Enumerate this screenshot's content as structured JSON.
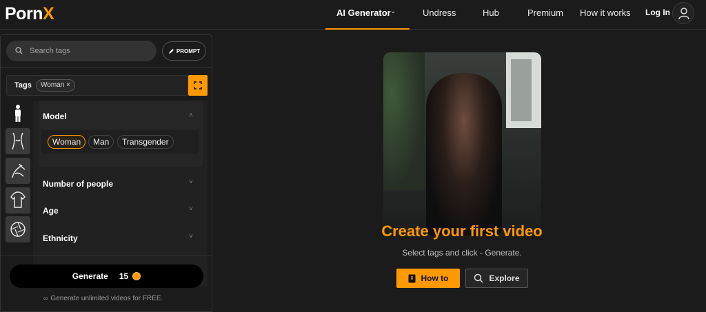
{
  "brand": {
    "logo_main": "Porn",
    "logo_accent": "X",
    "accent_color": "#ff9900"
  },
  "nav": {
    "active_label": "AI Generator",
    "items": [
      "Undress",
      "Hub",
      "Premium",
      "How it works"
    ],
    "login": "Log In"
  },
  "panel": {
    "search_placeholder": "Search tags",
    "prompt_label": "PROMPT",
    "tags_label": "Tags",
    "selected_tag": "Woman ×",
    "sections": {
      "model": {
        "title": "Model",
        "options": [
          "Woman",
          "Man",
          "Transgender"
        ],
        "selected": "Woman"
      },
      "number_of_people": {
        "title": "Number of people"
      },
      "age": {
        "title": "Age"
      },
      "ethnicity": {
        "title": "Ethnicity"
      }
    },
    "side_icons": [
      "person-icon",
      "body-icon",
      "pose-icon",
      "clothing-icon",
      "camera-lens-icon"
    ],
    "generate_label": "Generate",
    "generate_cost": "15",
    "free_note": "Generate unlimited videos for FREE."
  },
  "main": {
    "title": "Create your first video",
    "subtitle": "Select tags and click - Generate.",
    "howto_label": "How to",
    "explore_label": "Explore"
  }
}
